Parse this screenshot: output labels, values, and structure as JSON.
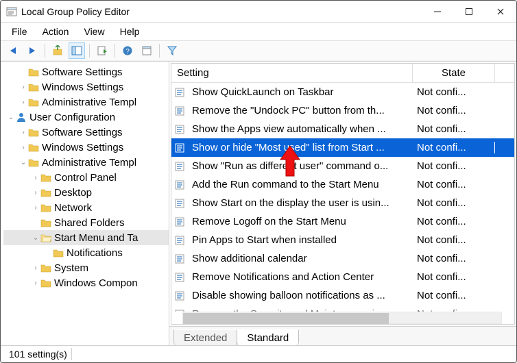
{
  "window": {
    "title": "Local Group Policy Editor"
  },
  "menu": {
    "file": "File",
    "action": "Action",
    "view": "View",
    "help": "Help"
  },
  "columns": {
    "setting": "Setting",
    "state": "State"
  },
  "column_widths": {
    "setting": 352,
    "state": 120
  },
  "tabs": {
    "extended": "Extended",
    "standard": "Standard",
    "active": "standard"
  },
  "status": {
    "count": "101 setting(s)"
  },
  "tree": [
    {
      "level": 1,
      "twisty": "",
      "icon": "folder",
      "label": "Software Settings"
    },
    {
      "level": 1,
      "twisty": ">",
      "icon": "folder",
      "label": "Windows Settings"
    },
    {
      "level": 1,
      "twisty": ">",
      "icon": "folder",
      "label": "Administrative Templ"
    },
    {
      "level": 0,
      "twisty": "v",
      "icon": "user",
      "label": "User Configuration"
    },
    {
      "level": 1,
      "twisty": ">",
      "icon": "folder",
      "label": "Software Settings"
    },
    {
      "level": 1,
      "twisty": ">",
      "icon": "folder",
      "label": "Windows Settings"
    },
    {
      "level": 1,
      "twisty": "v",
      "icon": "folder",
      "label": "Administrative Templ"
    },
    {
      "level": 2,
      "twisty": ">",
      "icon": "folder",
      "label": "Control Panel"
    },
    {
      "level": 2,
      "twisty": ">",
      "icon": "folder",
      "label": "Desktop"
    },
    {
      "level": 2,
      "twisty": ">",
      "icon": "folder",
      "label": "Network"
    },
    {
      "level": 2,
      "twisty": "",
      "icon": "folder",
      "label": "Shared Folders"
    },
    {
      "level": 2,
      "twisty": "v",
      "icon": "folder-open",
      "label": "Start Menu and Ta",
      "selected": true
    },
    {
      "level": 3,
      "twisty": "",
      "icon": "folder",
      "label": "Notifications"
    },
    {
      "level": 2,
      "twisty": ">",
      "icon": "folder",
      "label": "System"
    },
    {
      "level": 2,
      "twisty": ">",
      "icon": "folder",
      "label": "Windows Compon"
    }
  ],
  "settings": [
    {
      "label": "Show QuickLaunch on Taskbar",
      "state": "Not confi..."
    },
    {
      "label": "Remove the \"Undock PC\" button from th...",
      "state": "Not confi..."
    },
    {
      "label": "Show the Apps view automatically when ...",
      "state": "Not confi..."
    },
    {
      "label": "Show or hide \"Most used\" list from Start ...",
      "state": "Not confi...",
      "selected": true
    },
    {
      "label": "Show \"Run as different user\" command o...",
      "state": "Not confi..."
    },
    {
      "label": "Add the Run command to the Start Menu",
      "state": "Not confi..."
    },
    {
      "label": "Show Start on the display the user is usin...",
      "state": "Not confi..."
    },
    {
      "label": "Remove Logoff on the Start Menu",
      "state": "Not confi..."
    },
    {
      "label": "Pin Apps to Start when installed",
      "state": "Not confi..."
    },
    {
      "label": "Show additional calendar",
      "state": "Not confi..."
    },
    {
      "label": "Remove Notifications and Action Center",
      "state": "Not confi..."
    },
    {
      "label": "Disable showing balloon notifications as ...",
      "state": "Not confi..."
    },
    {
      "label": "Remove the Security and Maintenance ic",
      "state": "Not confi...",
      "partial": true
    }
  ],
  "icons": {
    "back": "back-icon",
    "forward": "forward-icon",
    "up": "up-icon",
    "show": "show-icon",
    "export": "export-icon",
    "help": "help-icon",
    "props": "props-icon",
    "filter": "filter-icon"
  },
  "colors": {
    "selection": "#0a64d8",
    "folder": "#f0c954",
    "text": "#000000"
  }
}
